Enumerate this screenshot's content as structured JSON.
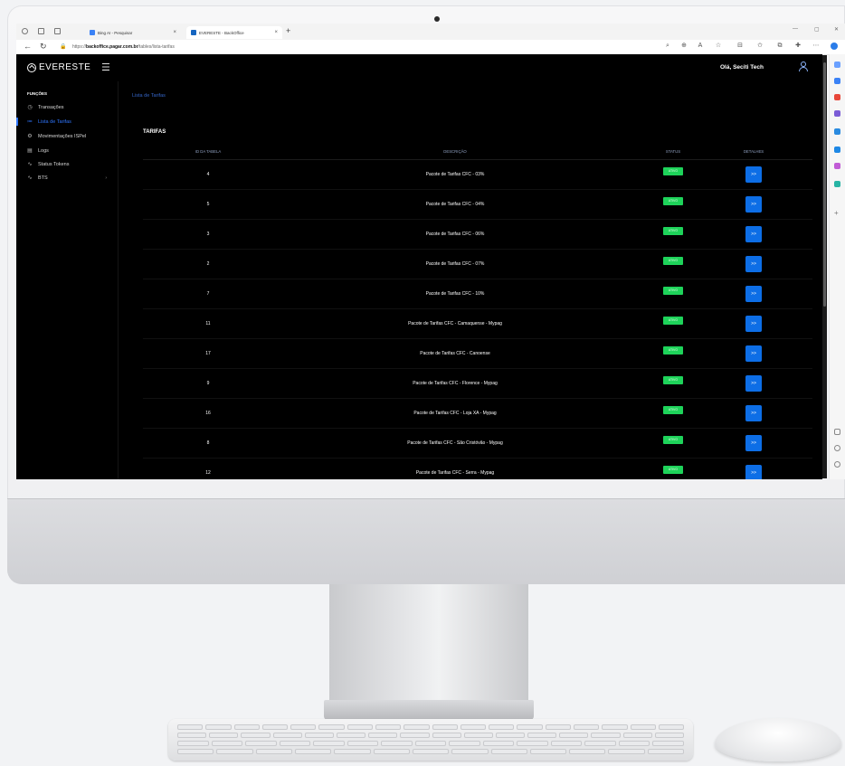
{
  "browser": {
    "tabs": [
      {
        "title": "Bing AI - Pesquisar",
        "favicon_color": "#3b82f6"
      },
      {
        "title": "EVERESTE - BackOffice",
        "favicon_color": "#1565c0"
      }
    ],
    "url_host": "backoffice.pagar.com.br",
    "url_prefix": "https://",
    "url_path": "/tables/lista-tarifas",
    "new_tab_icon": "plus-icon"
  },
  "app": {
    "logo_text": "EVERESTE",
    "greeting": "Olá, Seciti Tech",
    "accent_color": "#2f76ff",
    "sidebar": {
      "heading": "FUNÇÕES",
      "items": [
        {
          "label": "Transações",
          "icon": "clock-icon",
          "active": false
        },
        {
          "label": "Lista de Tarifas",
          "icon": "list-icon",
          "active": true
        },
        {
          "label": "Movimentações ISPel",
          "icon": "gear-icon",
          "active": false
        },
        {
          "label": "Logs",
          "icon": "document-icon",
          "active": false
        },
        {
          "label": "Status Tokens",
          "icon": "pulse-icon",
          "active": false
        },
        {
          "label": "BTS",
          "icon": "pulse-icon",
          "active": false,
          "has_submenu": true
        }
      ]
    },
    "breadcrumb": "Lista de Tarifas",
    "card_title": "TARIFAS",
    "table": {
      "headers": {
        "id": "ID DA TABELA",
        "description": "DESCRIÇÃO",
        "status": "STATUS",
        "details": "DETALHES"
      },
      "status_color": "#1ed35a",
      "button_color": "#0d6ee6",
      "rows": [
        {
          "id": "4",
          "description": "Pacote de Tarifas CFC - 03%",
          "status": "ATIVO",
          "action": ">>"
        },
        {
          "id": "5",
          "description": "Pacote de Tarifas CFC - 04%",
          "status": "ATIVO",
          "action": ">>"
        },
        {
          "id": "3",
          "description": "Pacote de Tarifas CFC - 06%",
          "status": "ATIVO",
          "action": ">>"
        },
        {
          "id": "2",
          "description": "Pacote de Tarifas CFC - 07%",
          "status": "ATIVO",
          "action": ">>"
        },
        {
          "id": "7",
          "description": "Pacote de Tarifas CFC - 10%",
          "status": "ATIVO",
          "action": ">>"
        },
        {
          "id": "11",
          "description": "Pacote de Tarifas CFC - Camaquense - Mypag",
          "status": "ATIVO",
          "action": ">>"
        },
        {
          "id": "17",
          "description": "Pacote de Tarifas CFC - Canoense",
          "status": "ATIVO",
          "action": ">>"
        },
        {
          "id": "9",
          "description": "Pacote de Tarifas CFC - Florence - Mypag",
          "status": "ATIVO",
          "action": ">>"
        },
        {
          "id": "16",
          "description": "Pacote de Tarifas CFC - Loja XA - Mypag",
          "status": "ATIVO",
          "action": ">>"
        },
        {
          "id": "8",
          "description": "Pacote de Tarifas CFC - São Cristóvão - Mypag",
          "status": "ATIVO",
          "action": ">>"
        },
        {
          "id": "12",
          "description": "Pacote de Tarifas CFC - Serra - Mypag",
          "status": "ATIVO",
          "action": ">>"
        }
      ]
    }
  }
}
